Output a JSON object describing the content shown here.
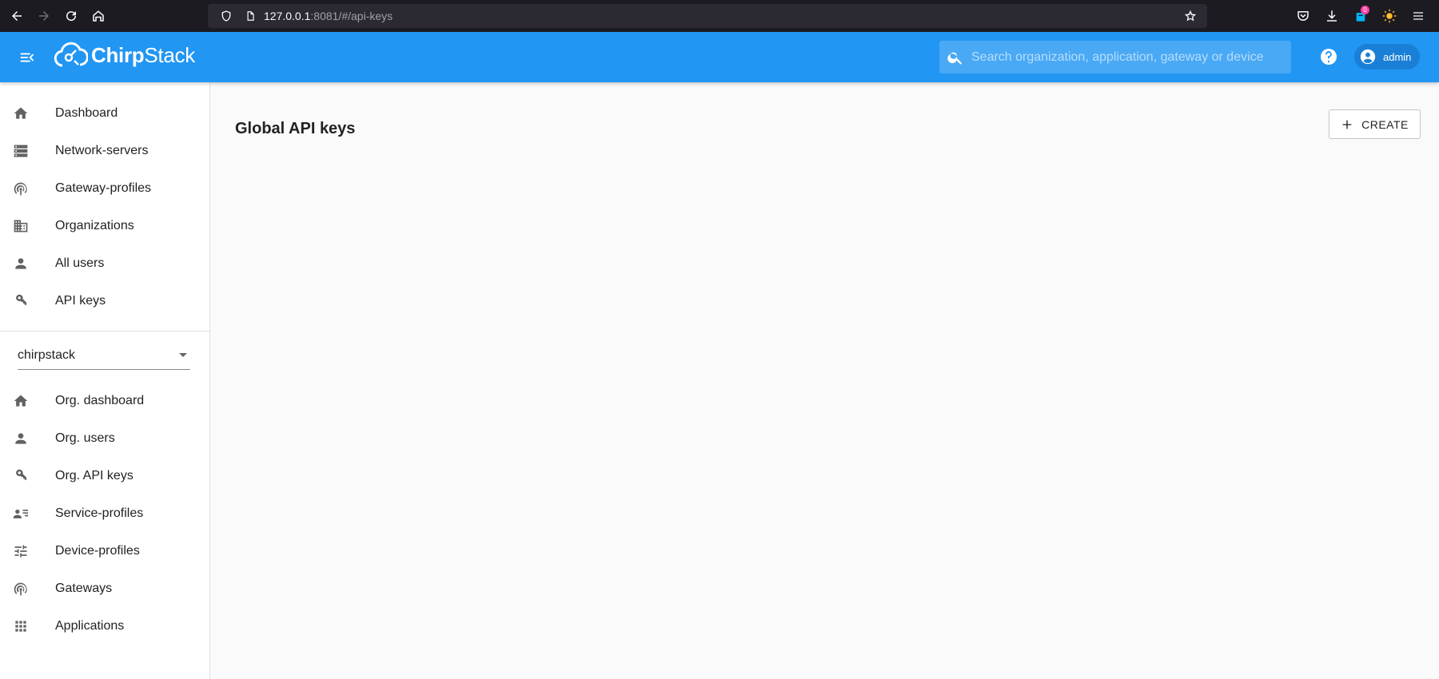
{
  "browser": {
    "url_host": "127.0.0.1",
    "url_rest": ":8081/#/api-keys",
    "notification_count": "0"
  },
  "header": {
    "logo_bold": "Chirp",
    "logo_thin": "Stack",
    "search_placeholder": "Search organization, application, gateway or device",
    "user_label": "admin",
    "color": "#2196f3"
  },
  "sidebar": {
    "global_items": [
      {
        "label": "Dashboard",
        "icon": "home-icon"
      },
      {
        "label": "Network-servers",
        "icon": "server-icon"
      },
      {
        "label": "Gateway-profiles",
        "icon": "antenna-icon"
      },
      {
        "label": "Organizations",
        "icon": "building-icon"
      },
      {
        "label": "All users",
        "icon": "person-icon"
      },
      {
        "label": "API keys",
        "icon": "key-icon"
      }
    ],
    "org_select_value": "chirpstack",
    "org_items": [
      {
        "label": "Org. dashboard",
        "icon": "home-icon"
      },
      {
        "label": "Org. users",
        "icon": "person-icon"
      },
      {
        "label": "Org. API keys",
        "icon": "key-icon"
      },
      {
        "label": "Service-profiles",
        "icon": "account-details-icon"
      },
      {
        "label": "Device-profiles",
        "icon": "tune-icon"
      },
      {
        "label": "Gateways",
        "icon": "antenna-icon"
      },
      {
        "label": "Applications",
        "icon": "apps-icon"
      }
    ]
  },
  "main": {
    "title": "Global API keys",
    "create_label": "CREATE"
  }
}
